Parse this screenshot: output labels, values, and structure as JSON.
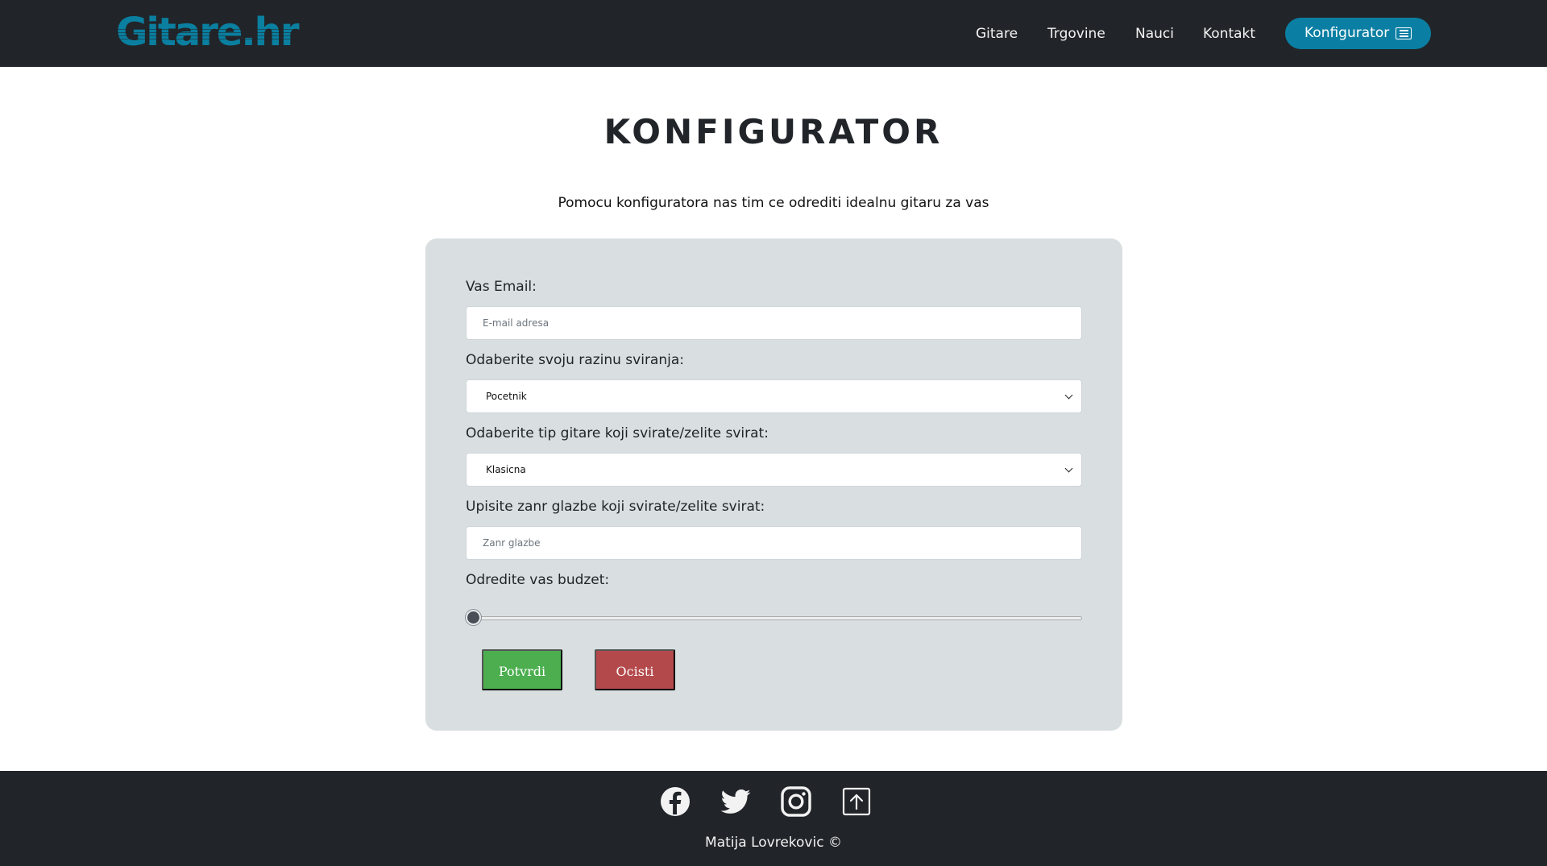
{
  "brand": {
    "logo_text": "Gitare.hr"
  },
  "nav": {
    "items": [
      {
        "label": "Gitare"
      },
      {
        "label": "Trgovine"
      },
      {
        "label": "Nauci"
      },
      {
        "label": "Kontakt"
      }
    ],
    "cta_label": "Konfigurator",
    "cta_icon": "list-icon"
  },
  "main": {
    "title": "KONFIGURATOR",
    "subtitle": "Pomocu konfiguratora nas tim ce odrediti idealnu gitaru za vas"
  },
  "form": {
    "email_label": "Vas Email:",
    "email_placeholder": "E-mail adresa",
    "email_value": "",
    "level_label": "Odaberite svoju razinu sviranja:",
    "level_selected": "Pocetnik",
    "type_label": "Odaberite tip gitare koji svirate/zelite svirat:",
    "type_selected": "Klasicna",
    "genre_label": "Upisite zanr glazbe koji svirate/zelite svirat:",
    "genre_placeholder": "Zanr glazbe",
    "genre_value": "",
    "budget_label": "Odredite vas budzet:",
    "budget_fraction": 0,
    "confirm_label": "Potvrdi",
    "clear_label": "Ocisti"
  },
  "footer": {
    "icons": [
      "facebook-icon",
      "twitter-icon",
      "instagram-icon",
      "arrow-up-icon"
    ],
    "copyright": "Matija Lovrekovic ©"
  },
  "colors": {
    "nav_bg": "#212529",
    "accent": "#0b7fa3",
    "card_bg": "#d9dfe0",
    "confirm": "#4cae4f",
    "clear": "#b4494b"
  }
}
